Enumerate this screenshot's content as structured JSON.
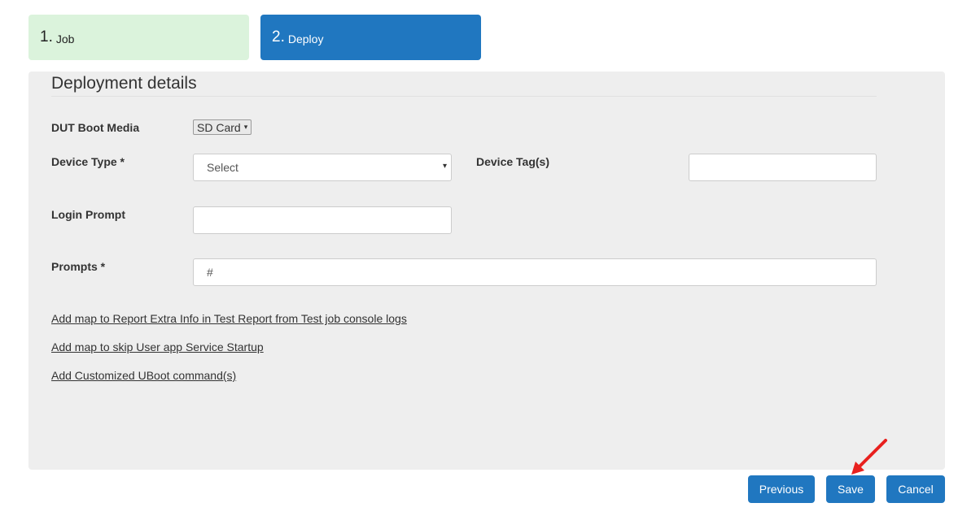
{
  "wizard": {
    "steps": [
      {
        "number": "1.",
        "label": "Job"
      },
      {
        "number": "2.",
        "label": "Deploy"
      }
    ]
  },
  "panel": {
    "title": "Deployment details",
    "fields": {
      "boot_media": {
        "label": "DUT Boot Media",
        "value": "SD Card"
      },
      "device_type": {
        "label": "Device Type *",
        "value": "Select"
      },
      "device_tags": {
        "label": "Device Tag(s)",
        "value": ""
      },
      "login_prompt": {
        "label": "Login Prompt",
        "value": ""
      },
      "prompts": {
        "label": "Prompts *",
        "value": "#"
      }
    },
    "links": [
      "Add map to Report Extra Info in Test Report from Test job console logs",
      "Add map to skip User app Service Startup",
      "Add Customized UBoot command(s)"
    ]
  },
  "buttons": {
    "previous": "Previous",
    "save": "Save",
    "cancel": "Cancel"
  },
  "colors": {
    "primary": "#2077c0",
    "step_done": "#dbf3dc",
    "panel_bg": "#eeeeee",
    "annotation": "#e8201e"
  },
  "icons": {
    "select_caret": "▾",
    "annotation": "red-arrow-icon"
  }
}
